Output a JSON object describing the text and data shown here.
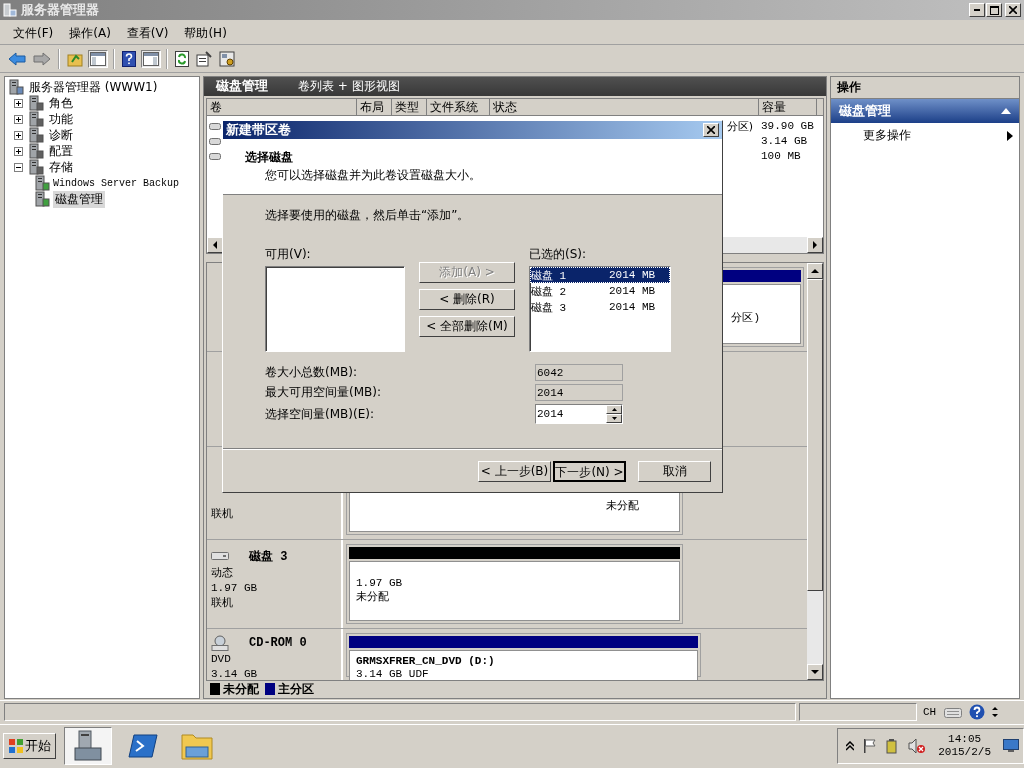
{
  "window": {
    "title": "服务器管理器"
  },
  "menu": [
    {
      "label": "文件(F)"
    },
    {
      "label": "操作(A)"
    },
    {
      "label": "查看(V)"
    },
    {
      "label": "帮助(H)"
    }
  ],
  "tree": {
    "label": "服务器管理器 (WWW1)",
    "selected": false,
    "children": [
      {
        "label": "角色",
        "expanded": false,
        "selected": false
      },
      {
        "label": "功能",
        "expanded": false,
        "selected": false
      },
      {
        "label": "诊断",
        "expanded": false,
        "selected": false
      },
      {
        "label": "配置",
        "expanded": false,
        "selected": false
      },
      {
        "label": "存储",
        "expanded": true,
        "selected": false,
        "children": [
          {
            "label": "Windows Server Backup",
            "selected": false
          },
          {
            "label": "磁盘管理",
            "selected": true
          }
        ]
      }
    ]
  },
  "center": {
    "title": "磁盘管理",
    "view": "卷列表 + 图形视图",
    "table": {
      "columns": [
        "卷",
        "布局",
        "类型",
        "文件系统",
        "状态",
        "容量"
      ],
      "rows": [
        {
          "status": "分区)",
          "capacity": "39.90 GB"
        },
        {
          "capacity": "3.14 GB"
        },
        {
          "capacity": "100 MB"
        }
      ]
    },
    "disks": [
      {
        "kind": "disk",
        "color": "#000080",
        "lines": [
          "分区)"
        ]
      },
      {
        "kind": "disk"
      },
      {
        "kind": "disk",
        "info": [
          "联机"
        ],
        "lines": [
          "未分配"
        ]
      },
      {
        "kind": "disk",
        "name": "磁盘 3",
        "info": [
          "动态",
          "1.97 GB",
          "联机"
        ],
        "color": "#000000",
        "lines": [
          "1.97 GB",
          "未分配"
        ]
      },
      {
        "kind": "cdrom",
        "name": "CD-ROM 0",
        "info": [
          "DVD",
          "3.14 GB"
        ],
        "color": "#000080",
        "title": "GRMSXFRER_CN_DVD  (D:)",
        "lines": [
          "3.14 GB UDF"
        ]
      }
    ],
    "legend": [
      {
        "label": "未分配",
        "color": "#000000"
      },
      {
        "label": "主分区",
        "color": "#000080"
      }
    ]
  },
  "actions": {
    "header": "操作",
    "section": "磁盘管理",
    "items": [
      {
        "label": "更多操作"
      }
    ]
  },
  "dialog": {
    "title": "新建带区卷",
    "heading": "选择磁盘",
    "subheading": "您可以选择磁盘并为此卷设置磁盘大小。",
    "instruction": "选择要使用的磁盘，然后单击“添加”。",
    "available_label": "可用(V):",
    "selected_label": "已选的(S):",
    "selected_disks": [
      {
        "name": "磁盘 1",
        "size": "2014 MB",
        "selected": true
      },
      {
        "name": "磁盘 2",
        "size": "2014 MB",
        "selected": false
      },
      {
        "name": "磁盘 3",
        "size": "2014 MB",
        "selected": false
      }
    ],
    "move_buttons": [
      {
        "label": "添加(A) >",
        "disabled": true
      },
      {
        "label": "< 删除(R)",
        "disabled": false
      },
      {
        "label": "< 全部删除(M)",
        "disabled": false
      }
    ],
    "fields": [
      {
        "label": "卷大小总数(MB):",
        "value": "6042",
        "kind": "readonly"
      },
      {
        "label": "最大可用空间量(MB):",
        "value": "2014",
        "kind": "readonly"
      },
      {
        "label": "选择空间量(MB)(E):",
        "value": "2014",
        "kind": "spinner"
      }
    ],
    "buttons": [
      {
        "label": "< 上一步(B)",
        "default": false
      },
      {
        "label": "下一步(N) >",
        "default": true
      },
      {
        "label": "取消",
        "default": false
      }
    ]
  },
  "status_bar": {
    "language": "CH"
  },
  "taskbar": {
    "start": "开始",
    "time": "14:05",
    "date": "2015/2/5"
  }
}
